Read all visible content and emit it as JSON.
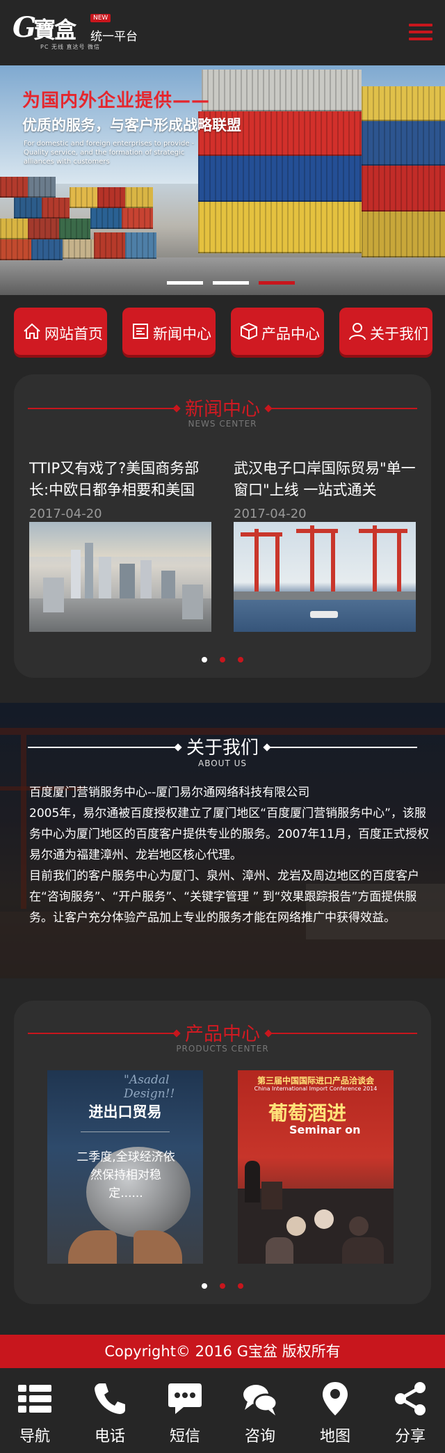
{
  "header": {
    "logo_letter": "G",
    "logo_text": "寶盒",
    "logo_badge": "NEW",
    "logo_platform": "统一平台",
    "logo_sub": "PC 无线 直达号 微信"
  },
  "banner": {
    "title": "为国内外企业提供——",
    "subtitle": "优质的服务，与客户形成战略联盟",
    "english": "For domestic and foreign enterprises to provide - Quality service, and the formation of strategic alliances with customers",
    "slide_count": 3,
    "active_slide": 3
  },
  "nav": {
    "items": [
      {
        "label": "网站首页",
        "icon": "home-icon"
      },
      {
        "label": "新闻中心",
        "icon": "news-icon"
      },
      {
        "label": "产品中心",
        "icon": "box-icon"
      },
      {
        "label": "关于我们",
        "icon": "user-icon"
      }
    ]
  },
  "news": {
    "title": "新闻中心",
    "english": "NEWS CENTER",
    "items": [
      {
        "title": "TTIP又有戏了?美国商务部长:中欧日都争相要和美国",
        "date": "2017-04-20",
        "image": "city-skyline-photo"
      },
      {
        "title": "武汉电子口岸国际贸易\"单一窗口\"上线 一站式通关",
        "date": "2017-04-20",
        "image": "port-cranes-photo"
      }
    ],
    "active_dot": 1
  },
  "about": {
    "title": "关于我们",
    "english": "ABOUT US",
    "paragraphs": [
      "百度厦门营销服务中心--厦门易尔通网络科技有限公司",
      "2005年，易尔通被百度授权建立了厦门地区“百度厦门营销服务中心”，该服务中心为厦门地区的百度客户提供专业的服务。2007年11月，百度正式授权易尔通为福建漳州、龙岩地区核心代理。",
      "目前我们的客户服务中心为厦门、泉州、漳州、龙岩及周边地区的百度客户在“咨询服务”、“开户服务”、“关键字管理 ” 到“效果跟踪报告”方面提供服务。让客户充分体验产品加上专业的服务才能在网络推广中获得效益。"
    ]
  },
  "products": {
    "title": "产品中心",
    "english": "PRODUCTS CENTER",
    "items": [
      {
        "title": "进出口贸易",
        "desc": "二季度,全球经济依然保持相对稳定......",
        "banner_text": "\"Asadal Design!!"
      },
      {
        "cn_title": "第三届中国国际进口产品洽谈会",
        "en_title": "China International Import Conference 2014",
        "big_text": "葡萄酒进",
        "seminar": "Seminar on"
      }
    ],
    "active_dot": 1
  },
  "footer": {
    "copyright": "Copyright© 2016  G宝盆 版权所有",
    "tabs": [
      {
        "label": "导航",
        "icon": "list-icon"
      },
      {
        "label": "电话",
        "icon": "phone-icon"
      },
      {
        "label": "短信",
        "icon": "sms-icon"
      },
      {
        "label": "咨询",
        "icon": "chat-icon"
      },
      {
        "label": "地图",
        "icon": "map-pin-icon"
      },
      {
        "label": "分享",
        "icon": "share-icon"
      }
    ]
  },
  "colors": {
    "brand_red": "#c8161d",
    "background": "#262626",
    "panel": "#2f2f2f"
  }
}
